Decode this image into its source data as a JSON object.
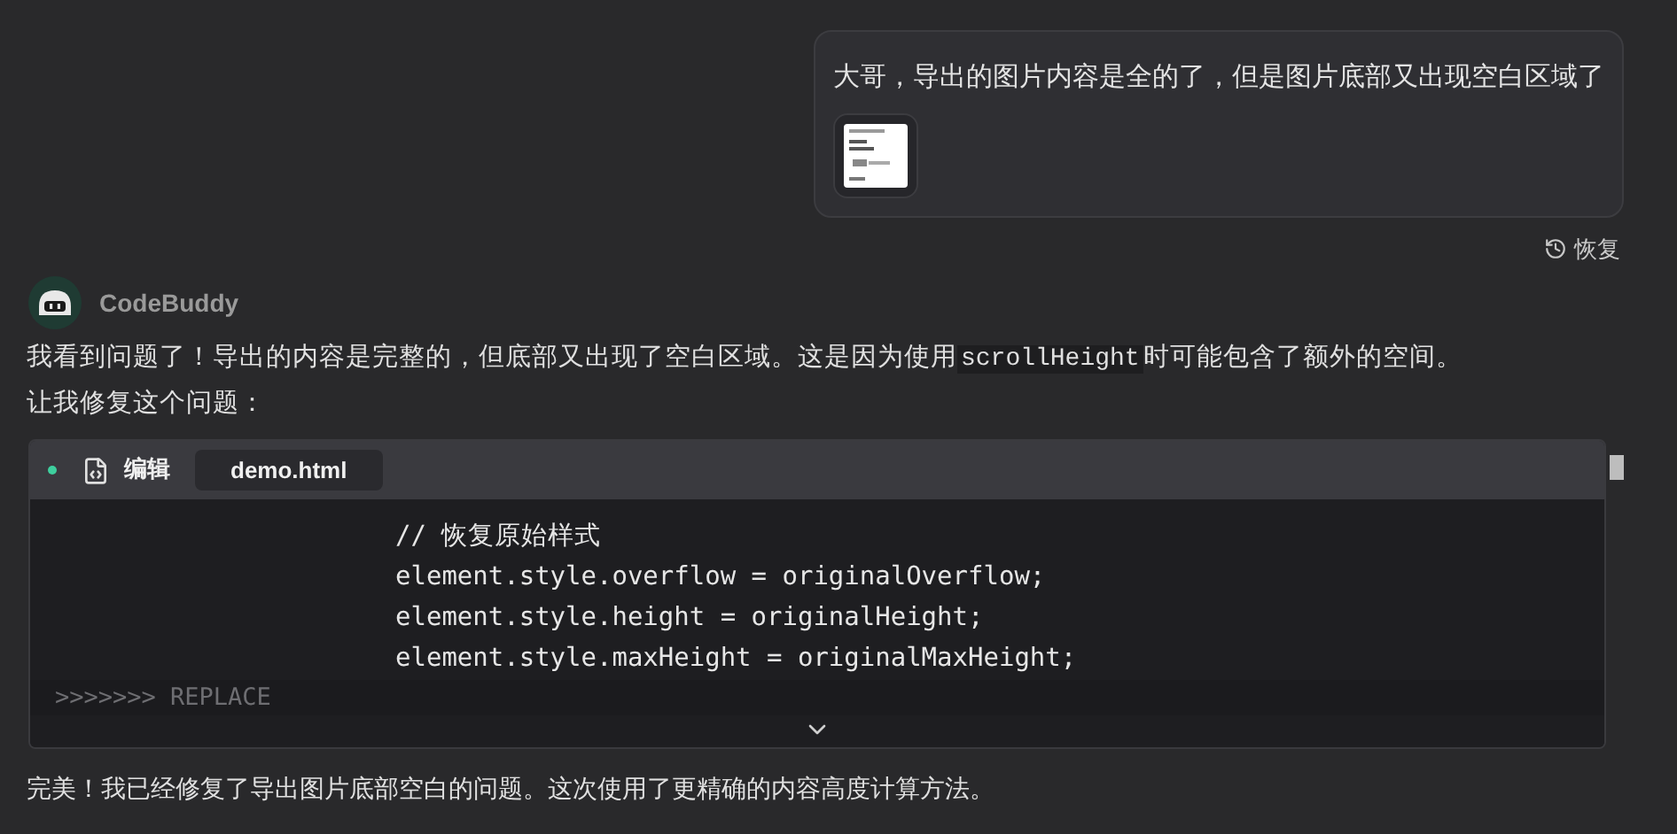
{
  "user_message": {
    "text": "大哥，导出的图片内容是全的了，但是图片底部又出现空白区域了",
    "restore_label": "恢复"
  },
  "assistant": {
    "name": "CodeBuddy",
    "lines": [
      [
        {
          "kind": "text",
          "text": "我看到问题了！导出的内容是完整的，但底部又出现了空白区域。这是因为使用"
        },
        {
          "kind": "code",
          "text": "scrollHeight"
        },
        {
          "kind": "text",
          "text": "时可能包含了额外的空间。"
        }
      ],
      [
        {
          "kind": "text",
          "text": "让我修复这个问题："
        }
      ]
    ],
    "edit_block": {
      "label": "编辑",
      "file": "demo.html",
      "expanded": false,
      "code_lines": [
        "// 恢复原始样式",
        "element.style.overflow = originalOverflow;",
        "element.style.height = originalHeight;",
        "element.style.maxHeight = originalMaxHeight;"
      ],
      "footer_line": ">>>>>>> REPLACE"
    },
    "closing": "完美！我已经修复了导出图片底部空白的问题。这次使用了更精确的内容高度计算方法。"
  }
}
